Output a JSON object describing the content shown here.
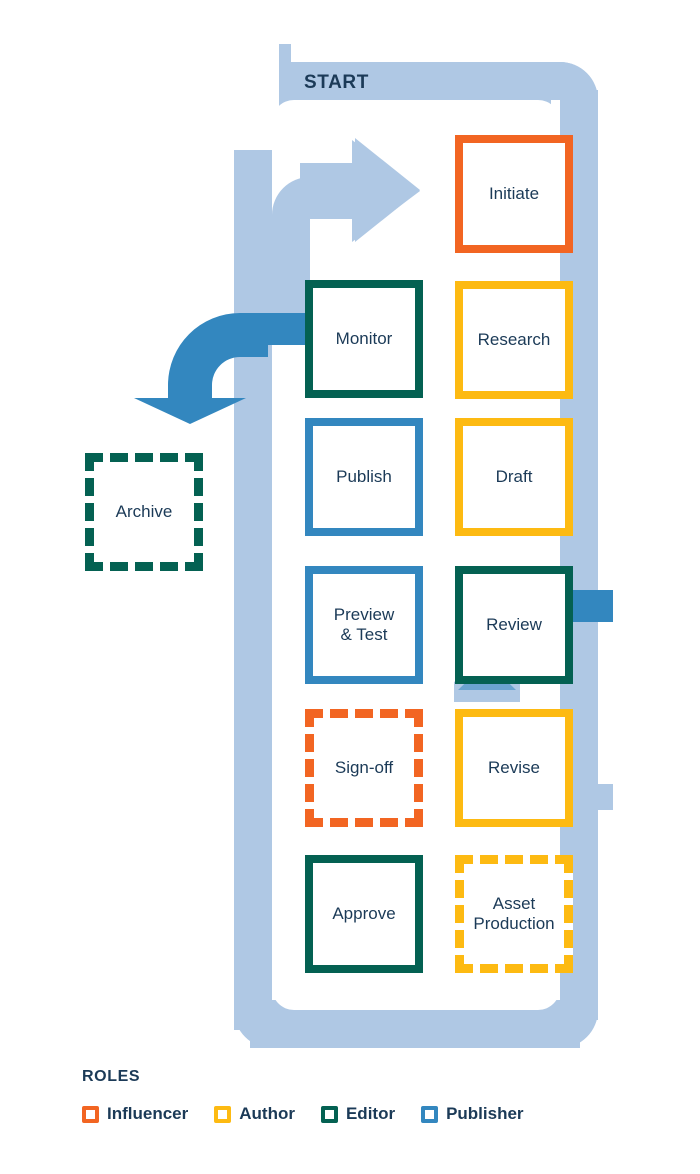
{
  "diagram": {
    "title_label": "START",
    "colors": {
      "influencer": "#F26522",
      "author": "#FDBA12",
      "editor": "#046152",
      "publisher": "#3387BF",
      "track": "#AFC8E4",
      "connector": "#3387BF",
      "text": "#1B3A57"
    },
    "nodes": [
      {
        "id": "initiate",
        "label": "Initiate",
        "role": "influencer",
        "style": "solid",
        "column": "right",
        "row": 1
      },
      {
        "id": "research",
        "label": "Research",
        "role": "author",
        "style": "solid",
        "column": "right",
        "row": 2
      },
      {
        "id": "draft",
        "label": "Draft",
        "role": "author",
        "style": "solid",
        "column": "right",
        "row": 3
      },
      {
        "id": "review",
        "label": "Review",
        "role": "editor",
        "style": "solid",
        "column": "right",
        "row": 4
      },
      {
        "id": "revise",
        "label": "Revise",
        "role": "author",
        "style": "solid",
        "column": "right",
        "row": 5
      },
      {
        "id": "asset-production",
        "label": "Asset\nProduction",
        "role": "author",
        "style": "dashed",
        "column": "right",
        "row": 6
      },
      {
        "id": "monitor",
        "label": "Monitor",
        "role": "editor",
        "style": "solid",
        "column": "left",
        "row": 2
      },
      {
        "id": "publish",
        "label": "Publish",
        "role": "publisher",
        "style": "solid",
        "column": "left",
        "row": 3
      },
      {
        "id": "preview-test",
        "label": "Preview\n& Test",
        "role": "publisher",
        "style": "solid",
        "column": "left",
        "row": 4
      },
      {
        "id": "sign-off",
        "label": "Sign-off",
        "role": "influencer",
        "style": "dashed",
        "column": "left",
        "row": 5
      },
      {
        "id": "approve",
        "label": "Approve",
        "role": "editor",
        "style": "solid",
        "column": "left",
        "row": 6
      },
      {
        "id": "archive",
        "label": "Archive",
        "role": "editor",
        "style": "dashed",
        "column": "far-left",
        "row": 3
      }
    ],
    "labels": {
      "initiate": "Initiate",
      "research": "Research",
      "draft": "Draft",
      "review": "Review",
      "revise": "Revise",
      "asset_production_line1": "Asset",
      "asset_production_line2": "Production",
      "monitor": "Monitor",
      "publish": "Publish",
      "preview_line1": "Preview",
      "preview_line2": "& Test",
      "sign_off": "Sign-off",
      "approve": "Approve",
      "archive": "Archive"
    }
  },
  "legend": {
    "title": "ROLES",
    "items": [
      {
        "label": "Influencer",
        "color": "#F26522"
      },
      {
        "label": "Author",
        "color": "#FDBA12"
      },
      {
        "label": "Editor",
        "color": "#046152"
      },
      {
        "label": "Publisher",
        "color": "#3387BF"
      }
    ]
  }
}
